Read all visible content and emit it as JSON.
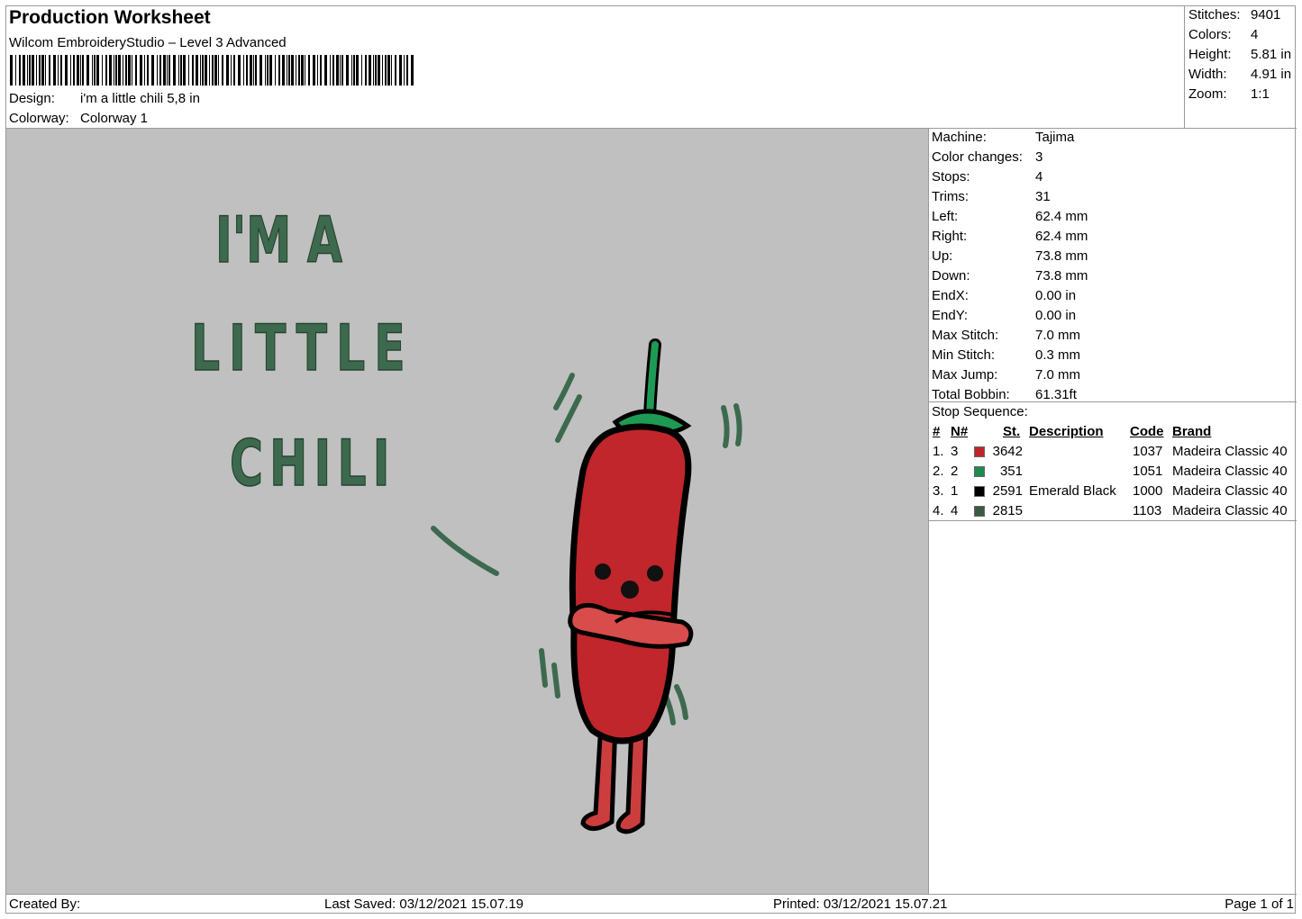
{
  "header": {
    "title": "Production Worksheet",
    "software": "Wilcom EmbroideryStudio – Level 3 Advanced",
    "design_label": "Design:",
    "design_value": "i'm a little chili 5,8 in",
    "colorway_label": "Colorway:",
    "colorway_value": "Colorway 1"
  },
  "stats": [
    {
      "label": "Stitches:",
      "value": "9401"
    },
    {
      "label": "Colors:",
      "value": "4"
    },
    {
      "label": "Height:",
      "value": "5.81 in"
    },
    {
      "label": "Width:",
      "value": "4.91 in"
    },
    {
      "label": "Zoom:",
      "value": "1:1"
    }
  ],
  "machine_info": [
    {
      "label": "Machine:",
      "value": "Tajima"
    },
    {
      "label": "Color changes:",
      "value": "3"
    },
    {
      "label": "Stops:",
      "value": "4"
    },
    {
      "label": "Trims:",
      "value": "31"
    },
    {
      "label": "Left:",
      "value": "62.4 mm"
    },
    {
      "label": "Right:",
      "value": "62.4 mm"
    },
    {
      "label": "Up:",
      "value": "73.8 mm"
    },
    {
      "label": "Down:",
      "value": "73.8 mm"
    },
    {
      "label": "EndX:",
      "value": "0.00 in"
    },
    {
      "label": "EndY:",
      "value": "0.00 in"
    },
    {
      "label": "Max Stitch:",
      "value": "7.0 mm"
    },
    {
      "label": "Min Stitch:",
      "value": "0.3 mm"
    },
    {
      "label": "Max Jump:",
      "value": "7.0 mm"
    },
    {
      "label": "Total Bobbin:",
      "value": "61.31ft"
    }
  ],
  "stop_sequence": {
    "label": "Stop Sequence:",
    "headers": {
      "num": "#",
      "n": "N#",
      "st": "St.",
      "desc": "Description",
      "code": "Code",
      "brand": "Brand"
    },
    "rows": [
      {
        "num": "1.",
        "n": "3",
        "color": "#c0242b",
        "st": "3642",
        "desc": "",
        "code": "1037",
        "brand": "Madeira Classic 40"
      },
      {
        "num": "2.",
        "n": "2",
        "color": "#1d8a4e",
        "st": "351",
        "desc": "",
        "code": "1051",
        "brand": "Madeira Classic 40"
      },
      {
        "num": "3.",
        "n": "1",
        "color": "#000000",
        "st": "2591",
        "desc": "Emerald Black",
        "code": "1000",
        "brand": "Madeira Classic 40"
      },
      {
        "num": "4.",
        "n": "4",
        "color": "#3a5a44",
        "st": "2815",
        "desc": "",
        "code": "1103",
        "brand": "Madeira Classic 40"
      }
    ]
  },
  "design_text": [
    "I'M A",
    "LITTLE",
    "CHILI"
  ],
  "footer": {
    "created_by": "Created By:",
    "last_saved": "Last Saved: 03/12/2021 15.07.19",
    "printed": "Printed: 03/12/2021 15.07.21",
    "page": "Page 1 of 1"
  }
}
